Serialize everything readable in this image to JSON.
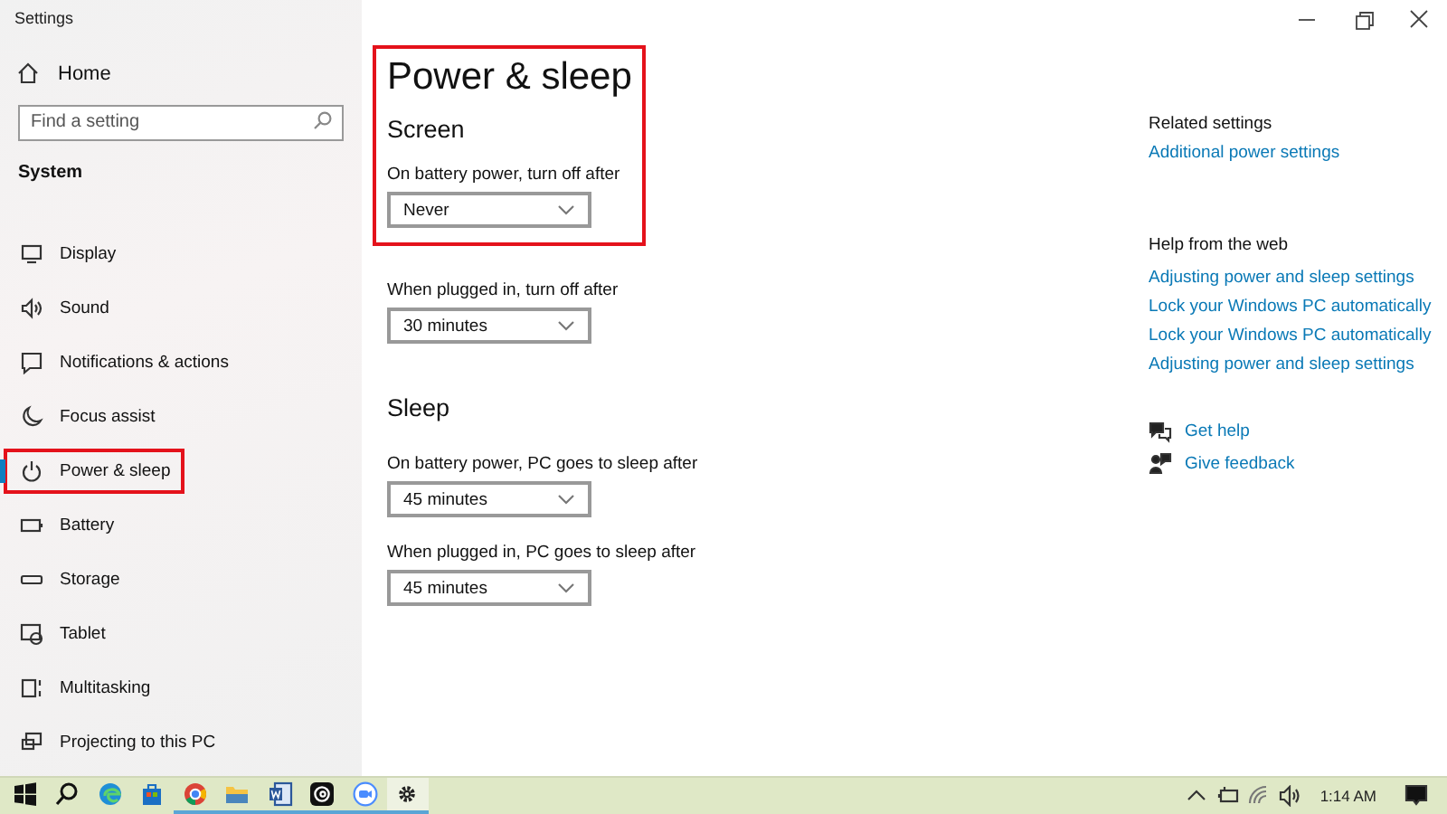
{
  "window": {
    "title": "Settings",
    "controls": [
      {
        "kind": "minimize"
      },
      {
        "kind": "restore"
      },
      {
        "kind": "close"
      }
    ]
  },
  "sidebar": {
    "home": "Home",
    "search": {
      "placeholder": "Find a setting"
    },
    "group": "System",
    "items": [
      {
        "label": "Display",
        "kind": "display",
        "selected": false,
        "highlighted": false
      },
      {
        "label": "Sound",
        "kind": "sound",
        "selected": false,
        "highlighted": false
      },
      {
        "label": "Notifications & actions",
        "kind": "notifications",
        "selected": false,
        "highlighted": false
      },
      {
        "label": "Focus assist",
        "kind": "focus",
        "selected": false,
        "highlighted": false
      },
      {
        "label": "Power & sleep",
        "kind": "power",
        "selected": true,
        "highlighted": true
      },
      {
        "label": "Battery",
        "kind": "battery",
        "selected": false,
        "highlighted": false
      },
      {
        "label": "Storage",
        "kind": "storage",
        "selected": false,
        "highlighted": false
      },
      {
        "label": "Tablet",
        "kind": "tablet",
        "selected": false,
        "highlighted": false
      },
      {
        "label": "Multitasking",
        "kind": "multitasking",
        "selected": false,
        "highlighted": false
      },
      {
        "label": "Projecting to this PC",
        "kind": "projecting",
        "selected": false,
        "highlighted": false
      }
    ]
  },
  "main": {
    "title": "Power & sleep",
    "highlighted": true,
    "sections": [
      {
        "heading": "Screen",
        "settings": [
          {
            "label": "On battery power, turn off after",
            "value": "Never"
          },
          {
            "label": "When plugged in, turn off after",
            "value": "30 minutes"
          }
        ]
      },
      {
        "heading": "Sleep",
        "settings": [
          {
            "label": "On battery power, PC goes to sleep after",
            "value": "45 minutes"
          },
          {
            "label": "When plugged in, PC goes to sleep after",
            "value": "45 minutes"
          }
        ]
      }
    ]
  },
  "aside": {
    "related": {
      "heading": "Related settings",
      "links": [
        "Additional power settings"
      ]
    },
    "help": {
      "heading": "Help from the web",
      "links": [
        "Adjusting power and sleep settings",
        "Lock your Windows PC automatically",
        "Lock your Windows PC automatically",
        "Adjusting power and sleep settings"
      ]
    },
    "actions": [
      {
        "label": "Get help",
        "kind": "help"
      },
      {
        "label": "Give feedback",
        "kind": "feedback"
      }
    ]
  },
  "taskbar": {
    "apps": [
      {
        "kind": "start",
        "running": false,
        "selected": false
      },
      {
        "kind": "search",
        "running": false,
        "selected": false
      },
      {
        "kind": "edge",
        "running": false,
        "selected": false
      },
      {
        "kind": "store",
        "running": false,
        "selected": false
      },
      {
        "kind": "chrome",
        "running": true,
        "selected": false
      },
      {
        "kind": "explorer",
        "running": true,
        "selected": false
      },
      {
        "kind": "word",
        "running": true,
        "selected": false
      },
      {
        "kind": "threads",
        "running": true,
        "selected": false
      },
      {
        "kind": "zoom",
        "running": true,
        "selected": false
      },
      {
        "kind": "settings",
        "running": true,
        "selected": true
      }
    ],
    "tray": [
      {
        "kind": "chevron"
      },
      {
        "kind": "battery"
      },
      {
        "kind": "wifi"
      },
      {
        "kind": "volume"
      }
    ],
    "time": "1:14 AM"
  }
}
